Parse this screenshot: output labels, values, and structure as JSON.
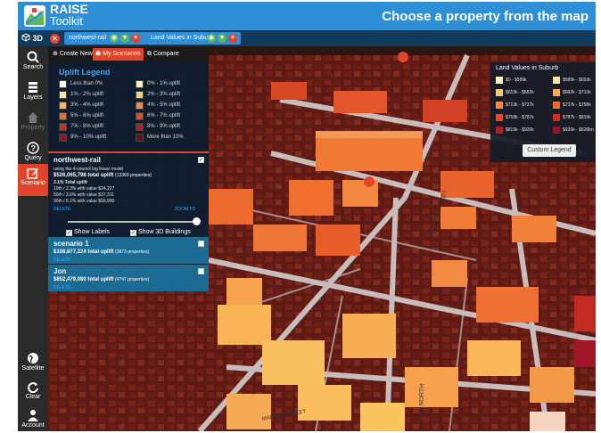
{
  "header": {
    "app_name": "RAISE",
    "app_sub": "Toolkit",
    "title": "Choose a property from the map"
  },
  "tabbar": {
    "view_mode": "3D",
    "chips": [
      {
        "label": "northwest-rail"
      },
      {
        "label": "Land Values in Suburb"
      }
    ]
  },
  "iconbar": {
    "items": [
      {
        "label": "Search",
        "icon": "search-icon"
      },
      {
        "label": "Layers",
        "icon": "layers-icon"
      },
      {
        "label": "Property",
        "icon": "home-icon"
      },
      {
        "label": "Query",
        "icon": "help-icon"
      },
      {
        "label": "Scenario",
        "icon": "edit-icon"
      },
      {
        "label": "Satellite",
        "icon": "globe-icon"
      },
      {
        "label": "Clear",
        "icon": "refresh-icon"
      },
      {
        "label": "Account",
        "icon": "user-icon"
      }
    ]
  },
  "panel": {
    "tabs": [
      {
        "label": "Create New"
      },
      {
        "label": "My Scenarios"
      },
      {
        "label": "Compare"
      }
    ],
    "legend_title": "Uplift Legend",
    "legend": [
      {
        "label": "Less than 0%",
        "color": "#ffffff"
      },
      {
        "label": "0% - 1% uplift",
        "color": "#fff5b8"
      },
      {
        "label": "1% - 2% uplift",
        "color": "#fde59a"
      },
      {
        "label": "2% - 3% uplift",
        "color": "#fdd27a"
      },
      {
        "label": "3% - 4% uplift",
        "color": "#fcb15a"
      },
      {
        "label": "4% - 5% uplift",
        "color": "#f68b42"
      },
      {
        "label": "5% - 6% uplift",
        "color": "#ef6b34"
      },
      {
        "label": "6% - 7% uplift",
        "color": "#e34a26"
      },
      {
        "label": "7% - 8% uplift",
        "color": "#cc2f1e"
      },
      {
        "label": "8% - 9% uplift",
        "color": "#b3201d"
      },
      {
        "label": "9% - 10% uplift",
        "color": "#931426"
      },
      {
        "label": "More than 10%",
        "color": "#6e0c22"
      }
    ],
    "scenario_main": {
      "title": "northwest-rail",
      "model": "using the 4-council log linear model",
      "total": "$526,065,798 total uplift",
      "total_count": "(13369 properties)",
      "pct": "3.1% Total uplift",
      "p10": "10th / 2.3% with value $24,227",
      "p50": "50th / 3.6% with value $37,311",
      "p90": "90th / 5.1% with value $56,990",
      "delete": "DELETE",
      "zoom": "ZOOM TO",
      "show_labels": "Show Labels",
      "show_3d": "Show 3D Buildings"
    },
    "scenarios": [
      {
        "title": "scenario 1",
        "total": "$108,877,224 total uplift",
        "count": "(3873 properties)",
        "delete": "DELETE"
      },
      {
        "title": "Jon",
        "total": "$852,479,080 total uplift",
        "count": "(4747 properties)",
        "delete": "DELETE"
      }
    ]
  },
  "land_values": {
    "title": "Land Values in Suburb",
    "minimize": "⊟",
    "rows": [
      {
        "label": "$0 - $589k",
        "color": "#fff5b8"
      },
      {
        "label": "$589k - $653k",
        "color": "#fde59a"
      },
      {
        "label": "$653k - $682k",
        "color": "#fcc670"
      },
      {
        "label": "$682k - $713k",
        "color": "#f9a84f"
      },
      {
        "label": "$713k - $737k",
        "color": "#f68b42"
      },
      {
        "label": "$737k - $758k",
        "color": "#ef6b34"
      },
      {
        "label": "$758k - $787k",
        "color": "#e34a26"
      },
      {
        "label": "$787k - $819k",
        "color": "#cc2f1e"
      },
      {
        "label": "$819k - $926k",
        "color": "#b3201d"
      },
      {
        "label": "$926k - $628bn",
        "color": "#931426"
      }
    ],
    "button": "Custom Legend"
  },
  "map": {
    "street_labels": [
      "HOLMES STREET",
      "OLD NORTH",
      "MARKET STREET"
    ]
  }
}
